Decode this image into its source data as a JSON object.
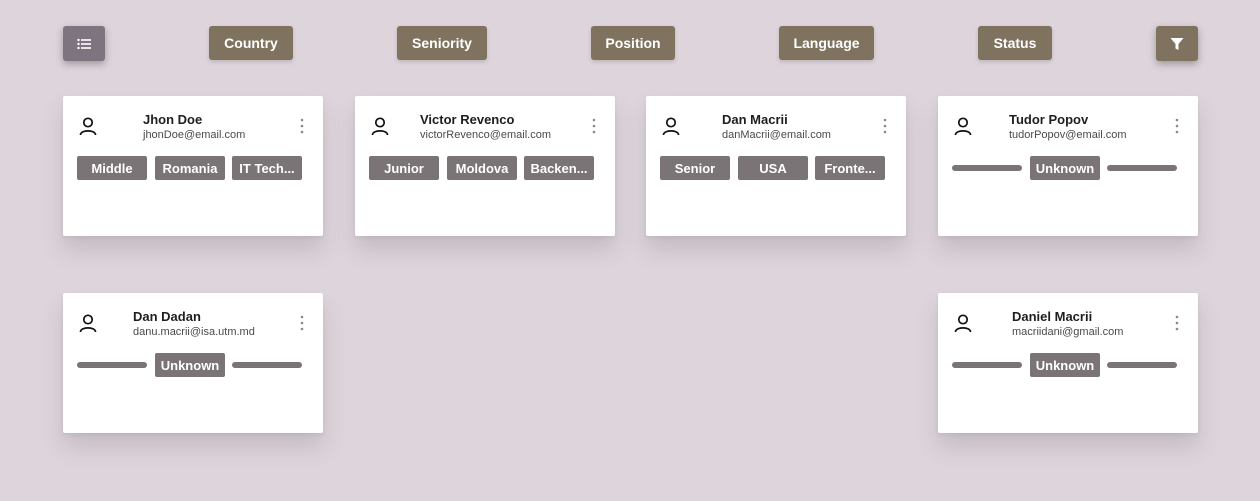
{
  "toolbar": {
    "view_icon": "list-icon",
    "filter_icon": "filter-icon",
    "filters": [
      "Country",
      "Seniority",
      "Position",
      "Language",
      "Status"
    ]
  },
  "colors": {
    "background": "#ddd5db",
    "toolbar_button": "#7f735f",
    "tag": "#7a7476"
  },
  "cards": [
    {
      "name": "Jhon Doe",
      "email": "jhonDoe@email.com",
      "tags": [
        "Middle",
        "Romania",
        "IT Tech..."
      ]
    },
    {
      "name": "Victor Revenco",
      "email": "victorRevenco@email.com",
      "tags": [
        "Junior",
        "Moldova",
        "Backen..."
      ]
    },
    {
      "name": "Dan Macrii",
      "email": "danMacrii@email.com",
      "tags": [
        "Senior",
        "USA",
        "Fronte..."
      ]
    },
    {
      "name": "Tudor Popov",
      "email": "tudorPopov@email.com",
      "status": "Unknown"
    },
    {
      "name": "Dan Dadan",
      "email": "danu.macrii@isa.utm.md",
      "status": "Unknown"
    },
    {
      "name": "Daniel Macrii",
      "email": "macriidani@gmail.com",
      "status": "Unknown"
    }
  ]
}
